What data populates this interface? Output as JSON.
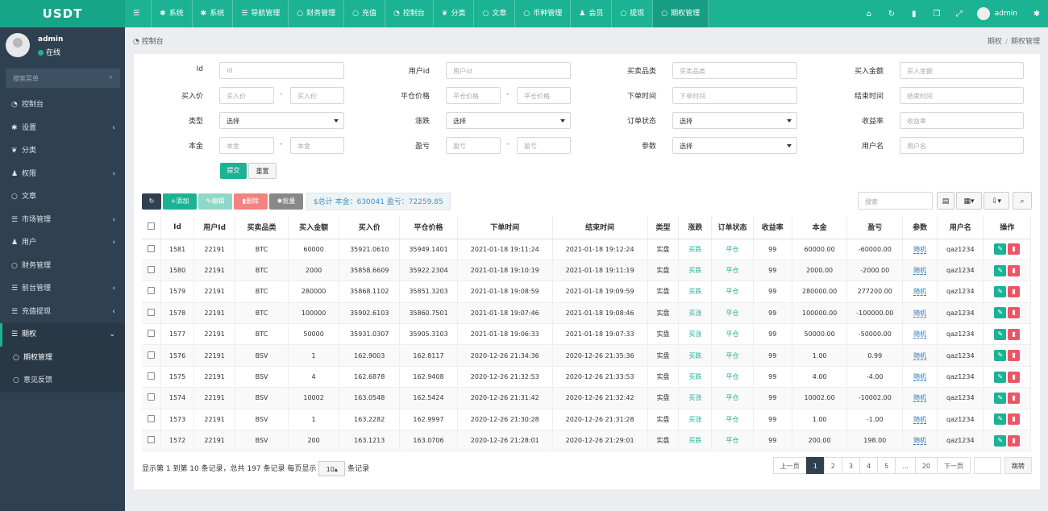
{
  "brand": "USDT",
  "topnav": [
    {
      "icon": "menu-icon",
      "glyph": "☰",
      "label": ""
    },
    {
      "icon": "gear-icon",
      "glyph": "✱",
      "label": "系统"
    },
    {
      "icon": "gear-icon",
      "glyph": "✱",
      "label": "系统"
    },
    {
      "icon": "list-icon",
      "glyph": "☰",
      "label": "导航管理"
    },
    {
      "icon": "circle-icon",
      "glyph": "○",
      "label": "财务管理"
    },
    {
      "icon": "circle-icon",
      "glyph": "○",
      "label": "充值"
    },
    {
      "icon": "dashboard-icon",
      "glyph": "◔",
      "label": "控制台"
    },
    {
      "icon": "leaf-icon",
      "glyph": "❦",
      "label": "分类"
    },
    {
      "icon": "circle-icon",
      "glyph": "○",
      "label": "文章"
    },
    {
      "icon": "circle-icon",
      "glyph": "○",
      "label": "币种管理"
    },
    {
      "icon": "user-icon",
      "glyph": "♟",
      "label": "会员"
    },
    {
      "icon": "circle-icon",
      "glyph": "○",
      "label": "提现"
    },
    {
      "icon": "circle-icon",
      "glyph": "○",
      "label": "期权管理"
    }
  ],
  "topright": {
    "icons": [
      "home-icon",
      "refresh-icon",
      "trash-icon",
      "copy-icon",
      "fullscreen-icon"
    ],
    "glyphs": [
      "⌂",
      "↻",
      "▮",
      "❐",
      "⤢"
    ],
    "user": "admin",
    "settings_glyph": "✱"
  },
  "user": {
    "name": "admin",
    "status": "在线"
  },
  "sidebar_search": "搜索菜单",
  "menu": [
    {
      "glyph": "◔",
      "label": "控制台",
      "arrow": ""
    },
    {
      "glyph": "✱",
      "label": "设置",
      "arrow": "‹"
    },
    {
      "glyph": "❦",
      "label": "分类",
      "arrow": ""
    },
    {
      "glyph": "♟",
      "label": "权限",
      "arrow": "‹"
    },
    {
      "glyph": "○",
      "label": "文章",
      "arrow": ""
    },
    {
      "glyph": "☰",
      "label": "市场管理",
      "arrow": "‹"
    },
    {
      "glyph": "♟",
      "label": "用户",
      "arrow": "‹"
    },
    {
      "glyph": "○",
      "label": "财务管理",
      "arrow": ""
    },
    {
      "glyph": "☰",
      "label": "前台管理",
      "arrow": "‹"
    },
    {
      "glyph": "☰",
      "label": "充值提现",
      "arrow": "‹"
    },
    {
      "glyph": "☰",
      "label": "期权",
      "arrow": "⌄"
    },
    {
      "glyph": "○",
      "label": "期权管理",
      "arrow": ""
    },
    {
      "glyph": "○",
      "label": "意见反馈",
      "arrow": ""
    }
  ],
  "breadcrumb": {
    "left": "控制台",
    "p1": "期权",
    "sep": "/",
    "p2": "期权管理"
  },
  "filters": {
    "id": {
      "label": "Id",
      "ph": "id"
    },
    "uid": {
      "label": "用户id",
      "ph": "用户id"
    },
    "cat": {
      "label": "买卖品类",
      "ph": "买卖品类"
    },
    "amt": {
      "label": "买入金额",
      "ph": "买入金额"
    },
    "bp": {
      "label": "买入价",
      "ph": "买入价"
    },
    "cp": {
      "label": "平仓价格",
      "ph": "平仓价格"
    },
    "ot": {
      "label": "下单时间",
      "ph": "下单时间"
    },
    "et": {
      "label": "结束时间",
      "ph": "结束时间"
    },
    "type": {
      "label": "类型",
      "val": "选择"
    },
    "rise": {
      "label": "涨跌",
      "val": "选择"
    },
    "ost": {
      "label": "订单状态",
      "val": "选择"
    },
    "rate": {
      "label": "收益率",
      "ph": "收益率"
    },
    "cap": {
      "label": "本金",
      "ph": "本金"
    },
    "pl": {
      "label": "盈亏",
      "ph": "盈亏"
    },
    "param": {
      "label": "参数",
      "val": "选择"
    },
    "uname": {
      "label": "用户名",
      "ph": "用户名"
    },
    "dash": "-"
  },
  "buttons": {
    "submit": "提交",
    "reset": "重置",
    "add": "+添加",
    "edit": "✎编辑",
    "del": "▮删除",
    "batch": "✱批量",
    "refresh": "↻"
  },
  "summary": "$总计 本金：630041 盈亏：72259.85",
  "search_ph": "搜索",
  "tool_glyphs": [
    "▤",
    "▦▾",
    "⇩▾",
    "⌕"
  ],
  "table": {
    "headers": [
      "Id",
      "用户Id",
      "买卖品类",
      "买入金额",
      "买入价",
      "平仓价格",
      "下单时间",
      "结束时间",
      "类型",
      "涨跌",
      "订单状态",
      "收益率",
      "本金",
      "盈亏",
      "参数",
      "用户名",
      "操作"
    ],
    "rows": [
      [
        "1581",
        "22191",
        "BTC",
        "60000",
        "35921.0610",
        "35949.1401",
        "2021-01-18 19:11:24",
        "2021-01-18 19:12:24",
        "实盘",
        "买跌",
        "平仓",
        "99",
        "60000.00",
        "-60000.00",
        "随机",
        "qaz1234"
      ],
      [
        "1580",
        "22191",
        "BTC",
        "2000",
        "35858.6609",
        "35922.2304",
        "2021-01-18 19:10:19",
        "2021-01-18 19:11:19",
        "实盘",
        "买跌",
        "平仓",
        "99",
        "2000.00",
        "-2000.00",
        "随机",
        "qaz1234"
      ],
      [
        "1579",
        "22191",
        "BTC",
        "280000",
        "35868.1102",
        "35851.3203",
        "2021-01-18 19:08:59",
        "2021-01-18 19:09:59",
        "实盘",
        "买跌",
        "平仓",
        "99",
        "280000.00",
        "277200.00",
        "随机",
        "qaz1234"
      ],
      [
        "1578",
        "22191",
        "BTC",
        "100000",
        "35902.6103",
        "35860.7501",
        "2021-01-18 19:07:46",
        "2021-01-18 19:08:46",
        "实盘",
        "买涨",
        "平仓",
        "99",
        "100000.00",
        "-100000.00",
        "随机",
        "qaz1234"
      ],
      [
        "1577",
        "22191",
        "BTC",
        "50000",
        "35931.0307",
        "35905.3103",
        "2021-01-18 19:06:33",
        "2021-01-18 19:07:33",
        "实盘",
        "买涨",
        "平仓",
        "99",
        "50000.00",
        "-50000.00",
        "随机",
        "qaz1234"
      ],
      [
        "1576",
        "22191",
        "BSV",
        "1",
        "162.9003",
        "162.8117",
        "2020-12-26 21:34:36",
        "2020-12-26 21:35:36",
        "实盘",
        "买跌",
        "平仓",
        "99",
        "1.00",
        "0.99",
        "随机",
        "qaz1234"
      ],
      [
        "1575",
        "22191",
        "BSV",
        "4",
        "162.6878",
        "162.9408",
        "2020-12-26 21:32:53",
        "2020-12-26 21:33:53",
        "实盘",
        "买跌",
        "平仓",
        "99",
        "4.00",
        "-4.00",
        "随机",
        "qaz1234"
      ],
      [
        "1574",
        "22191",
        "BSV",
        "10002",
        "163.0548",
        "162.5424",
        "2020-12-26 21:31:42",
        "2020-12-26 21:32:42",
        "实盘",
        "买涨",
        "平仓",
        "99",
        "10002.00",
        "-10002.00",
        "随机",
        "qaz1234"
      ],
      [
        "1573",
        "22191",
        "BSV",
        "1",
        "163.2282",
        "162.9997",
        "2020-12-26 21:30:28",
        "2020-12-26 21:31:28",
        "实盘",
        "买涨",
        "平仓",
        "99",
        "1.00",
        "-1.00",
        "随机",
        "qaz1234"
      ],
      [
        "1572",
        "22191",
        "BSV",
        "200",
        "163.1213",
        "163.0706",
        "2020-12-26 21:28:01",
        "2020-12-26 21:29:01",
        "实盘",
        "买跌",
        "平仓",
        "99",
        "200.00",
        "198.00",
        "随机",
        "qaz1234"
      ]
    ]
  },
  "footer": {
    "pre": "显示第 1 到第 10 条记录，总共 197 条记录 每页显示",
    "per": "10▴",
    "post": "条记录"
  },
  "pager": {
    "prev": "上一页",
    "pages": [
      "1",
      "2",
      "3",
      "4",
      "5",
      "...",
      "20"
    ],
    "next": "下一页",
    "go": "跳转"
  },
  "colors": {
    "primary": "#1cb394",
    "sidebar": "#2f4050",
    "danger": "#ed5565"
  }
}
